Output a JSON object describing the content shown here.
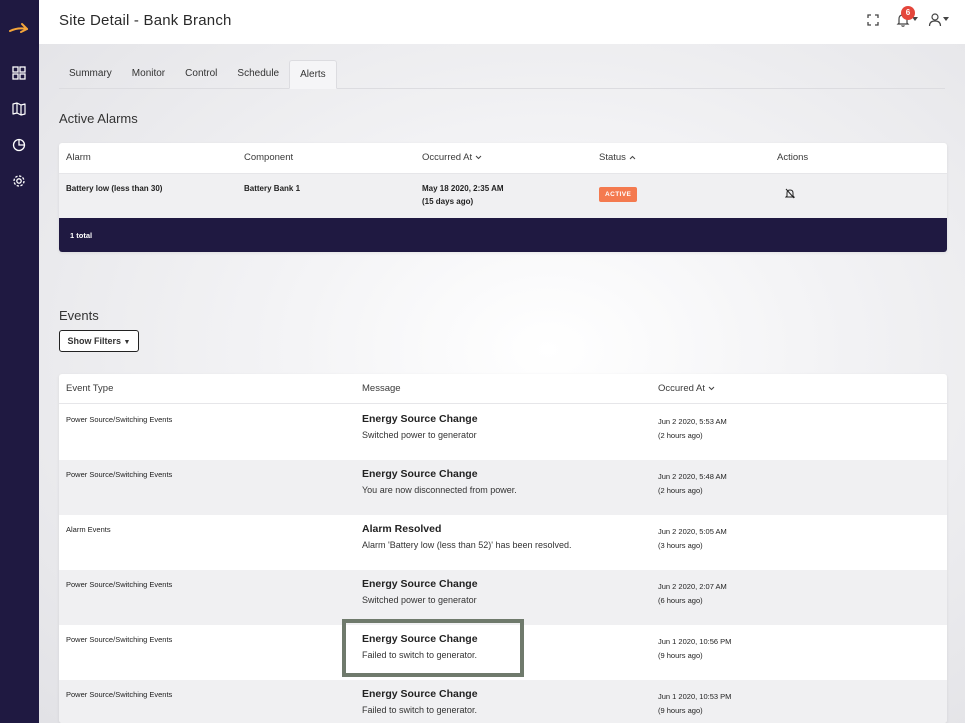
{
  "page": {
    "title": "Site Detail - Bank Branch"
  },
  "topbar": {
    "notification_count": "6"
  },
  "sidebar": {
    "items": [
      {
        "name": "dashboard",
        "icon": "grid-icon"
      },
      {
        "name": "map",
        "icon": "map-icon"
      },
      {
        "name": "reports",
        "icon": "pie-chart-icon"
      },
      {
        "name": "settings",
        "icon": "gear-icon"
      }
    ]
  },
  "tabs": [
    {
      "label": "Summary"
    },
    {
      "label": "Monitor"
    },
    {
      "label": "Control"
    },
    {
      "label": "Schedule"
    },
    {
      "label": "Alerts",
      "active": true
    }
  ],
  "alarms": {
    "title": "Active Alarms",
    "headers": {
      "alarm": "Alarm",
      "component": "Component",
      "occurred": "Occurred At",
      "status": "Status",
      "actions": "Actions"
    },
    "rows": [
      {
        "alarm": "Battery low (less than 30)",
        "component": "Battery Bank 1",
        "date": "May 18 2020, 2:35 AM",
        "ago": "(15 days ago)",
        "status": "ACTIVE"
      }
    ],
    "total": "1 total",
    "colors": {
      "status_active": "#f47a4f",
      "footer": "#1f1941"
    }
  },
  "events": {
    "title": "Events",
    "filter_label": "Show Filters",
    "headers": {
      "type": "Event Type",
      "message": "Message",
      "occurred": "Occured At"
    },
    "rows": [
      {
        "type": "Power Source/Switching Events",
        "title": "Energy Source Change",
        "msg": "Switched power to generator",
        "date": "Jun 2 2020, 5:53 AM",
        "ago": "(2 hours ago)"
      },
      {
        "type": "Power Source/Switching Events",
        "title": "Energy Source Change",
        "msg": "You are now disconnected from power.",
        "date": "Jun 2 2020, 5:48 AM",
        "ago": "(2 hours ago)"
      },
      {
        "type": "Alarm Events",
        "title": "Alarm Resolved",
        "msg": "Alarm 'Battery low (less than 52)' has been resolved.",
        "date": "Jun 2 2020, 5:05 AM",
        "ago": "(3 hours ago)"
      },
      {
        "type": "Power Source/Switching Events",
        "title": "Energy Source Change",
        "msg": "Switched power to generator",
        "date": "Jun 2 2020, 2:07 AM",
        "ago": "(6 hours ago)"
      },
      {
        "type": "Power Source/Switching Events",
        "title": "Energy Source Change",
        "msg": "Failed to switch to generator.",
        "date": "Jun 1 2020, 10:56 PM",
        "ago": "(9 hours ago)"
      },
      {
        "type": "Power Source/Switching Events",
        "title": "Energy Source Change",
        "msg": "Failed to switch to generator.",
        "date": "Jun 1 2020, 10:53 PM",
        "ago": "(9 hours ago)"
      }
    ]
  }
}
